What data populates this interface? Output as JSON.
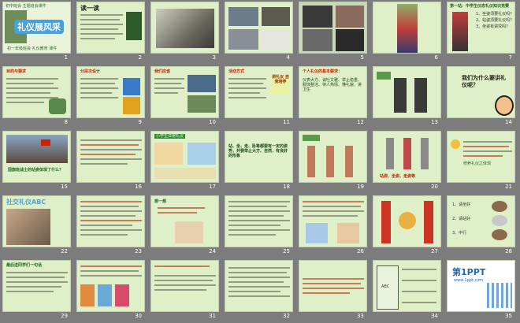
{
  "slides": [
    {
      "n": "1",
      "title": "礼仪展风采",
      "top": "初中班会 主题班会课件",
      "bottom": "初一年级班会 礼仪教育 课件"
    },
    {
      "n": "2",
      "title": "读一读"
    },
    {
      "n": "3"
    },
    {
      "n": "4"
    },
    {
      "n": "5"
    },
    {
      "n": "6"
    },
    {
      "n": "7",
      "title": "第一站：中学生仪态礼仪知识竞赛",
      "q1": "1、坐姿须要礼仪吗？",
      "q2": "2、站姿须要礼仪吗？",
      "q3": "3、坐姿有讲究吗？"
    },
    {
      "n": "8",
      "title": "目的与要求"
    },
    {
      "n": "9",
      "title": "分层次设计"
    },
    {
      "n": "10",
      "title": "我们应该"
    },
    {
      "n": "11",
      "title": "活动方式",
      "side": "讲礼仪 自我培养"
    },
    {
      "n": "12",
      "title": "个人礼仪的基本要求：",
      "body": "仪表大方、谈吐文雅、举止稳重、服饰整洁、待人热情、懂礼貌、讲卫生"
    },
    {
      "n": "13"
    },
    {
      "n": "14",
      "q": "我们为什么要讲礼仪呢？"
    },
    {
      "n": "15",
      "caption": "国旗班战士的站姿体现了什么？"
    },
    {
      "n": "16"
    },
    {
      "n": "17",
      "banner": "小学生日常礼仪"
    },
    {
      "n": "18",
      "body": "站、坐、走、卧等都要有一定的姿势，并要举止大方、自然，有良好的形象"
    },
    {
      "n": "19"
    },
    {
      "n": "20",
      "caption": "站姿、坐姿、走姿等"
    },
    {
      "n": "21",
      "body": "修养礼仪之体现"
    },
    {
      "n": "22",
      "title": "社交礼仪ABC"
    },
    {
      "n": "23"
    },
    {
      "n": "24",
      "q": "想一想"
    },
    {
      "n": "25"
    },
    {
      "n": "26"
    },
    {
      "n": "27"
    },
    {
      "n": "28",
      "i1": "1、请坐好",
      "i2": "2、请站好",
      "i3": "3、中行"
    },
    {
      "n": "29",
      "title": "最后送同学们一句话"
    },
    {
      "n": "30"
    },
    {
      "n": "31"
    },
    {
      "n": "32"
    },
    {
      "n": "33"
    },
    {
      "n": "34",
      "abc": "ABC"
    },
    {
      "n": "35",
      "logo": "第1PPT",
      "url": "www.1ppt.com"
    }
  ],
  "colors": {
    "bg": "#7c7c7c",
    "slide": "#dff0c8",
    "accent": "#cc2200",
    "select": "#f2c200"
  }
}
